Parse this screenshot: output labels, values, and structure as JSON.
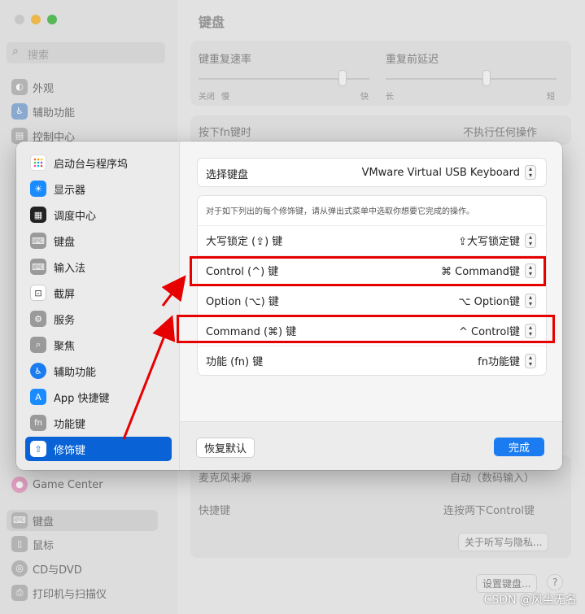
{
  "window": {
    "title": "键盘"
  },
  "search": {
    "placeholder": "搜索"
  },
  "bg_sidebar": {
    "items_top": [
      "外观",
      "辅助功能",
      "控制中心"
    ],
    "items_bottom": [
      "Game Center",
      "键盘",
      "鼠标",
      "CD与DVD",
      "打印机与扫描仪"
    ]
  },
  "bg_main": {
    "repeat_rate_label": "键重复速率",
    "repeat_delay_label": "重复前延迟",
    "rate_ticks": [
      "关闭",
      "慢",
      "快"
    ],
    "delay_ticks": [
      "长",
      "短"
    ],
    "fn_label": "按下fn键时",
    "fn_value": "不执行任何操作",
    "mic_label": "麦克风来源",
    "mic_value": "自动（数码输入）",
    "shortcut_label": "快捷键",
    "shortcut_value": "连按两下Control键",
    "privacy_button": "关于听写与隐私...",
    "setup_keyboard_button": "设置键盘...",
    "help_button": "?"
  },
  "sheet": {
    "sidebar": [
      {
        "label": "启动台与程序坞",
        "icon": "launchpad-icon",
        "color": "#ffffff"
      },
      {
        "label": "显示器",
        "icon": "display-icon",
        "color": "#1a8cff"
      },
      {
        "label": "调度中心",
        "icon": "mission-control-icon",
        "color": "#222222"
      },
      {
        "label": "键盘",
        "icon": "keyboard-icon",
        "color": "#9a9a9a"
      },
      {
        "label": "输入法",
        "icon": "input-method-icon",
        "color": "#9a9a9a"
      },
      {
        "label": "截屏",
        "icon": "screenshot-icon",
        "color": "#ffffff"
      },
      {
        "label": "服务",
        "icon": "services-icon",
        "color": "#9a9a9a"
      },
      {
        "label": "聚焦",
        "icon": "spotlight-icon",
        "color": "#9a9a9a"
      },
      {
        "label": "辅助功能",
        "icon": "accessibility-icon",
        "color": "#1a7cf0"
      },
      {
        "label": "App 快捷键",
        "icon": "app-store-icon",
        "color": "#1a8cff"
      },
      {
        "label": "功能键",
        "icon": "fn-key-icon",
        "color": "#9a9a9a"
      },
      {
        "label": "修饰键",
        "icon": "modifier-key-icon",
        "color": "#ffffff"
      }
    ],
    "selected_index": 11,
    "select_keyboard_label": "选择键盘",
    "select_keyboard_value": "VMware Virtual USB Keyboard",
    "description": "对于如下列出的每个修饰键，请从弹出式菜单中选取你想要它完成的操作。",
    "rows": [
      {
        "label": "大写锁定 (⇪) 键",
        "value": "⇪大写锁定键"
      },
      {
        "label": "Control (^) 键",
        "value": "⌘ Command键"
      },
      {
        "label": "Option (⌥) 键",
        "value": "⌥ Option键"
      },
      {
        "label": "Command (⌘) 键",
        "value": "^ Control键"
      },
      {
        "label": "功能 (fn) 键",
        "value": "fn功能键"
      }
    ],
    "restore_button": "恢复默认",
    "done_button": "完成"
  },
  "annotation_color": "#e60000",
  "watermark": "CSDN @风尘无名"
}
